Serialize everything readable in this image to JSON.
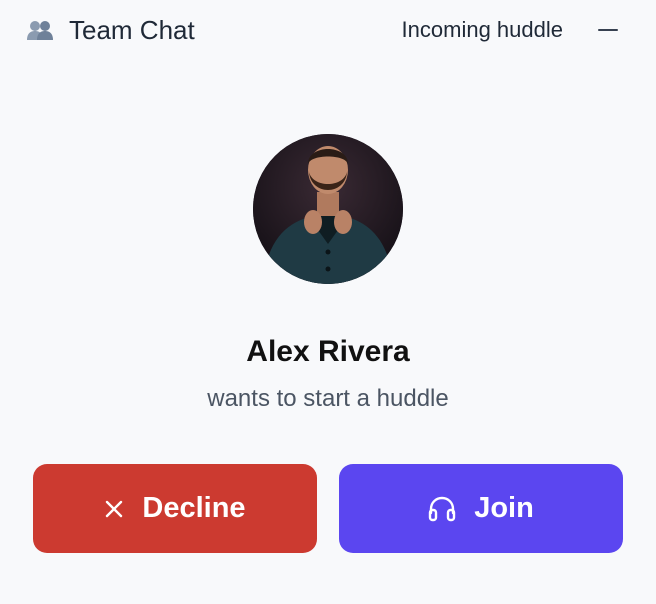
{
  "header": {
    "app_icon": "people-icon",
    "app_title": "Team Chat",
    "status": "Incoming huddle",
    "minimize_icon": "minimize-icon"
  },
  "caller": {
    "avatar": "caller-photo",
    "name": "Alex Rivera",
    "subtitle": "wants to start a huddle"
  },
  "actions": {
    "decline": {
      "label": "Decline",
      "icon": "close-icon",
      "color": "#cc3a30"
    },
    "join": {
      "label": "Join",
      "icon": "headphones-icon",
      "color": "#5b46f0"
    }
  },
  "colors": {
    "background": "#f8f9fb",
    "text_primary": "#111111",
    "text_secondary": "#4b5563"
  }
}
